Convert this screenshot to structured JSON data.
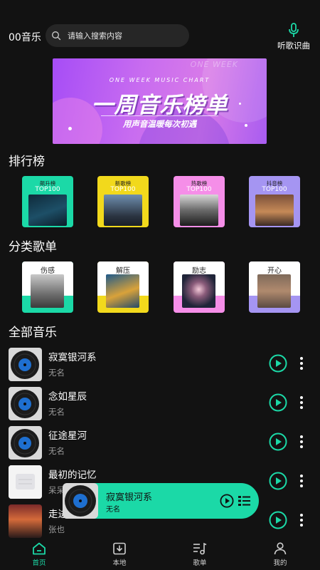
{
  "header": {
    "app_name": "00音乐",
    "search_placeholder": "请输入搜索内容",
    "recognize_label": "听歌识曲"
  },
  "banner": {
    "week_text": "ONE WEEK",
    "subtitle": "ONE WEEK MUSIC CHART",
    "title": "一周音乐榜单",
    "slogan": "用声音温暖每次初遇"
  },
  "sections": {
    "rank": "排行榜",
    "category": "分类歌单",
    "all": "全部音乐"
  },
  "rank_cards": [
    {
      "name": "飙升榜",
      "top": "TOP100",
      "color": "#1bd9a7"
    },
    {
      "name": "新歌榜",
      "top": "TOP100",
      "color": "#f2d91c"
    },
    {
      "name": "热歌榜",
      "top": "TOP100",
      "color": "#f58ee8"
    },
    {
      "name": "抖音榜",
      "top": "TOP100",
      "color": "#a595f2"
    }
  ],
  "category_cards": [
    {
      "name": "伤感",
      "color": "#1bd9a7"
    },
    {
      "name": "解压",
      "color": "#f2d91c"
    },
    {
      "name": "励志",
      "color": "#f58ee8"
    },
    {
      "name": "开心",
      "color": "#a595f2"
    }
  ],
  "songs": [
    {
      "title": "寂寞银河系",
      "artist": "无名"
    },
    {
      "title": "念如星辰",
      "artist": "无名"
    },
    {
      "title": "征途星河",
      "artist": "无名"
    },
    {
      "title": "最初的记忆",
      "artist": "呆呆"
    },
    {
      "title": "走进",
      "artist": "张也"
    }
  ],
  "mini_player": {
    "title": "寂寞银河系",
    "artist": "无名"
  },
  "tabs": [
    {
      "label": "首页",
      "icon": "home-icon",
      "active": true
    },
    {
      "label": "本地",
      "icon": "download-icon",
      "active": false
    },
    {
      "label": "歌单",
      "icon": "playlist-icon",
      "active": false
    },
    {
      "label": "我的",
      "icon": "user-icon",
      "active": false
    }
  ],
  "colors": {
    "accent": "#1bd9a7",
    "background": "#121212"
  }
}
